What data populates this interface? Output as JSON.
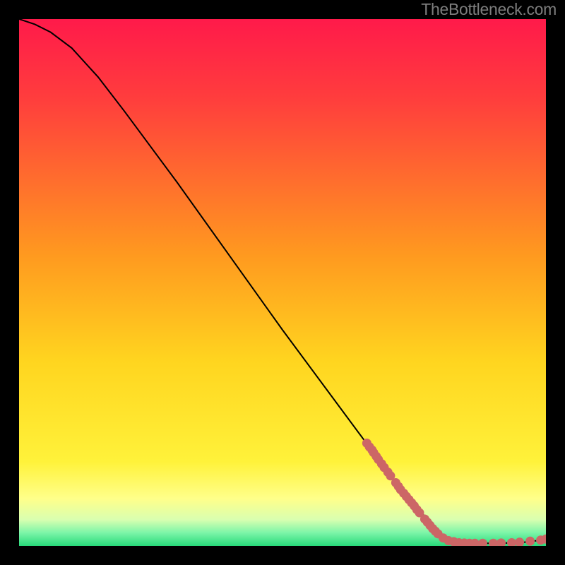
{
  "watermark": "TheBottleneck.com",
  "chart_data": {
    "type": "line",
    "title": "",
    "xlabel": "",
    "ylabel": "",
    "xlim": [
      0,
      100
    ],
    "ylim": [
      0,
      100
    ],
    "curve": [
      {
        "x": 0,
        "y": 100
      },
      {
        "x": 3,
        "y": 99
      },
      {
        "x": 6,
        "y": 97.5
      },
      {
        "x": 10,
        "y": 94.5
      },
      {
        "x": 15,
        "y": 89
      },
      {
        "x": 20,
        "y": 82.5
      },
      {
        "x": 30,
        "y": 69
      },
      {
        "x": 40,
        "y": 55
      },
      {
        "x": 50,
        "y": 41
      },
      {
        "x": 60,
        "y": 27.5
      },
      {
        "x": 70,
        "y": 14
      },
      {
        "x": 80,
        "y": 2
      },
      {
        "x": 82,
        "y": 0.8
      },
      {
        "x": 85,
        "y": 0.5
      },
      {
        "x": 90,
        "y": 0.5
      },
      {
        "x": 95,
        "y": 0.6
      },
      {
        "x": 100,
        "y": 1.2
      }
    ],
    "scatter": [
      {
        "x": 66,
        "y": 19.5
      },
      {
        "x": 66.5,
        "y": 18.8
      },
      {
        "x": 67,
        "y": 18.2
      },
      {
        "x": 67.3,
        "y": 17.7
      },
      {
        "x": 67.8,
        "y": 17.0
      },
      {
        "x": 68.2,
        "y": 16.4
      },
      {
        "x": 68.8,
        "y": 15.6
      },
      {
        "x": 69.3,
        "y": 14.9
      },
      {
        "x": 70.0,
        "y": 14.0
      },
      {
        "x": 70.5,
        "y": 13.3
      },
      {
        "x": 71.5,
        "y": 12.0
      },
      {
        "x": 72.0,
        "y": 11.3
      },
      {
        "x": 72.4,
        "y": 10.7
      },
      {
        "x": 73.0,
        "y": 10.0
      },
      {
        "x": 73.5,
        "y": 9.4
      },
      {
        "x": 74.0,
        "y": 8.8
      },
      {
        "x": 74.5,
        "y": 8.2
      },
      {
        "x": 75.0,
        "y": 7.6
      },
      {
        "x": 75.5,
        "y": 6.9
      },
      {
        "x": 76.0,
        "y": 6.3
      },
      {
        "x": 77.0,
        "y": 5.1
      },
      {
        "x": 77.5,
        "y": 4.5
      },
      {
        "x": 78.0,
        "y": 3.9
      },
      {
        "x": 78.5,
        "y": 3.3
      },
      {
        "x": 79.0,
        "y": 2.8
      },
      {
        "x": 79.5,
        "y": 2.3
      },
      {
        "x": 80.5,
        "y": 1.5
      },
      {
        "x": 81.5,
        "y": 1.0
      },
      {
        "x": 82.5,
        "y": 0.8
      },
      {
        "x": 83.5,
        "y": 0.6
      },
      {
        "x": 84.5,
        "y": 0.55
      },
      {
        "x": 85.5,
        "y": 0.5
      },
      {
        "x": 86.5,
        "y": 0.5
      },
      {
        "x": 88.0,
        "y": 0.5
      },
      {
        "x": 90.0,
        "y": 0.5
      },
      {
        "x": 91.5,
        "y": 0.55
      },
      {
        "x": 93.5,
        "y": 0.6
      },
      {
        "x": 95.0,
        "y": 0.7
      },
      {
        "x": 97.0,
        "y": 0.9
      },
      {
        "x": 99.0,
        "y": 1.1
      },
      {
        "x": 100.0,
        "y": 1.3
      }
    ],
    "gradient_colors": [
      {
        "stop": 0,
        "color": "#ff1a4a"
      },
      {
        "stop": 0.15,
        "color": "#ff3d3d"
      },
      {
        "stop": 0.45,
        "color": "#ff9a1f"
      },
      {
        "stop": 0.65,
        "color": "#ffd51f"
      },
      {
        "stop": 0.84,
        "color": "#fff23a"
      },
      {
        "stop": 0.91,
        "color": "#ffff8a"
      },
      {
        "stop": 0.95,
        "color": "#d9ffb0"
      },
      {
        "stop": 0.975,
        "color": "#7cf5a8"
      },
      {
        "stop": 1.0,
        "color": "#28d97a"
      }
    ],
    "scatter_color": "#cc6666",
    "curve_color": "#000000"
  }
}
